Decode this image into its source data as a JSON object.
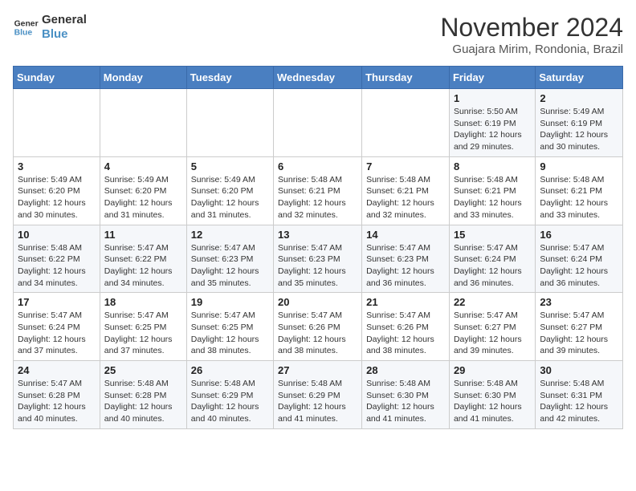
{
  "header": {
    "logo_line1": "General",
    "logo_line2": "Blue",
    "month": "November 2024",
    "location": "Guajara Mirim, Rondonia, Brazil"
  },
  "weekdays": [
    "Sunday",
    "Monday",
    "Tuesday",
    "Wednesday",
    "Thursday",
    "Friday",
    "Saturday"
  ],
  "weeks": [
    [
      {
        "day": "",
        "info": ""
      },
      {
        "day": "",
        "info": ""
      },
      {
        "day": "",
        "info": ""
      },
      {
        "day": "",
        "info": ""
      },
      {
        "day": "",
        "info": ""
      },
      {
        "day": "1",
        "info": "Sunrise: 5:50 AM\nSunset: 6:19 PM\nDaylight: 12 hours and 29 minutes."
      },
      {
        "day": "2",
        "info": "Sunrise: 5:49 AM\nSunset: 6:19 PM\nDaylight: 12 hours and 30 minutes."
      }
    ],
    [
      {
        "day": "3",
        "info": "Sunrise: 5:49 AM\nSunset: 6:20 PM\nDaylight: 12 hours and 30 minutes."
      },
      {
        "day": "4",
        "info": "Sunrise: 5:49 AM\nSunset: 6:20 PM\nDaylight: 12 hours and 31 minutes."
      },
      {
        "day": "5",
        "info": "Sunrise: 5:49 AM\nSunset: 6:20 PM\nDaylight: 12 hours and 31 minutes."
      },
      {
        "day": "6",
        "info": "Sunrise: 5:48 AM\nSunset: 6:21 PM\nDaylight: 12 hours and 32 minutes."
      },
      {
        "day": "7",
        "info": "Sunrise: 5:48 AM\nSunset: 6:21 PM\nDaylight: 12 hours and 32 minutes."
      },
      {
        "day": "8",
        "info": "Sunrise: 5:48 AM\nSunset: 6:21 PM\nDaylight: 12 hours and 33 minutes."
      },
      {
        "day": "9",
        "info": "Sunrise: 5:48 AM\nSunset: 6:21 PM\nDaylight: 12 hours and 33 minutes."
      }
    ],
    [
      {
        "day": "10",
        "info": "Sunrise: 5:48 AM\nSunset: 6:22 PM\nDaylight: 12 hours and 34 minutes."
      },
      {
        "day": "11",
        "info": "Sunrise: 5:47 AM\nSunset: 6:22 PM\nDaylight: 12 hours and 34 minutes."
      },
      {
        "day": "12",
        "info": "Sunrise: 5:47 AM\nSunset: 6:23 PM\nDaylight: 12 hours and 35 minutes."
      },
      {
        "day": "13",
        "info": "Sunrise: 5:47 AM\nSunset: 6:23 PM\nDaylight: 12 hours and 35 minutes."
      },
      {
        "day": "14",
        "info": "Sunrise: 5:47 AM\nSunset: 6:23 PM\nDaylight: 12 hours and 36 minutes."
      },
      {
        "day": "15",
        "info": "Sunrise: 5:47 AM\nSunset: 6:24 PM\nDaylight: 12 hours and 36 minutes."
      },
      {
        "day": "16",
        "info": "Sunrise: 5:47 AM\nSunset: 6:24 PM\nDaylight: 12 hours and 36 minutes."
      }
    ],
    [
      {
        "day": "17",
        "info": "Sunrise: 5:47 AM\nSunset: 6:24 PM\nDaylight: 12 hours and 37 minutes."
      },
      {
        "day": "18",
        "info": "Sunrise: 5:47 AM\nSunset: 6:25 PM\nDaylight: 12 hours and 37 minutes."
      },
      {
        "day": "19",
        "info": "Sunrise: 5:47 AM\nSunset: 6:25 PM\nDaylight: 12 hours and 38 minutes."
      },
      {
        "day": "20",
        "info": "Sunrise: 5:47 AM\nSunset: 6:26 PM\nDaylight: 12 hours and 38 minutes."
      },
      {
        "day": "21",
        "info": "Sunrise: 5:47 AM\nSunset: 6:26 PM\nDaylight: 12 hours and 38 minutes."
      },
      {
        "day": "22",
        "info": "Sunrise: 5:47 AM\nSunset: 6:27 PM\nDaylight: 12 hours and 39 minutes."
      },
      {
        "day": "23",
        "info": "Sunrise: 5:47 AM\nSunset: 6:27 PM\nDaylight: 12 hours and 39 minutes."
      }
    ],
    [
      {
        "day": "24",
        "info": "Sunrise: 5:47 AM\nSunset: 6:28 PM\nDaylight: 12 hours and 40 minutes."
      },
      {
        "day": "25",
        "info": "Sunrise: 5:48 AM\nSunset: 6:28 PM\nDaylight: 12 hours and 40 minutes."
      },
      {
        "day": "26",
        "info": "Sunrise: 5:48 AM\nSunset: 6:29 PM\nDaylight: 12 hours and 40 minutes."
      },
      {
        "day": "27",
        "info": "Sunrise: 5:48 AM\nSunset: 6:29 PM\nDaylight: 12 hours and 41 minutes."
      },
      {
        "day": "28",
        "info": "Sunrise: 5:48 AM\nSunset: 6:30 PM\nDaylight: 12 hours and 41 minutes."
      },
      {
        "day": "29",
        "info": "Sunrise: 5:48 AM\nSunset: 6:30 PM\nDaylight: 12 hours and 41 minutes."
      },
      {
        "day": "30",
        "info": "Sunrise: 5:48 AM\nSunset: 6:31 PM\nDaylight: 12 hours and 42 minutes."
      }
    ]
  ]
}
